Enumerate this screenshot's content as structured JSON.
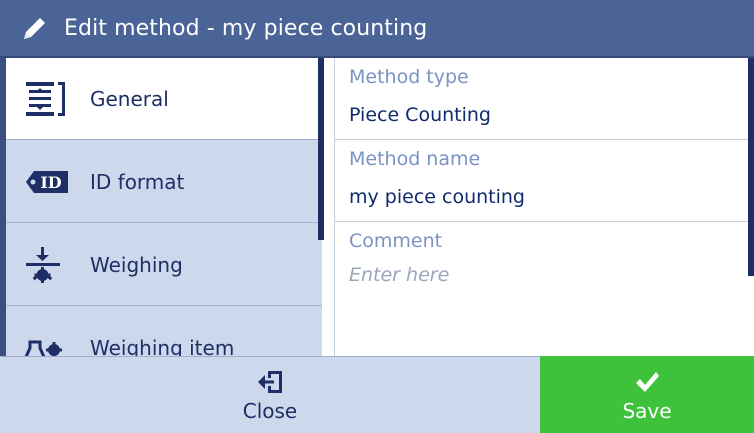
{
  "window": {
    "title": "Edit method - my piece counting",
    "title_icon": "pencil-icon"
  },
  "nav": {
    "items": [
      {
        "label": "General",
        "icon": "general-list-icon",
        "selected": true
      },
      {
        "label": "ID format",
        "icon": "id-tag-icon",
        "selected": false
      },
      {
        "label": "Weighing",
        "icon": "weighing-gear-icon",
        "selected": false
      },
      {
        "label": "Weighing item",
        "icon": "weighing-item-flask-icon",
        "selected": false
      }
    ]
  },
  "detail": {
    "method_type": {
      "label": "Method type",
      "value": "Piece Counting"
    },
    "method_name": {
      "label": "Method name",
      "value": "my piece counting"
    },
    "comment": {
      "label": "Comment",
      "placeholder": "Enter here"
    }
  },
  "footer": {
    "close_label": "Close",
    "close_icon": "exit-door-icon",
    "save_label": "Save",
    "save_icon": "checkmark-icon"
  },
  "colors": {
    "title_bar": "#4a6497",
    "nav_background": "#cdd8ec",
    "nav_selected": "#ffffff",
    "text_dark": "#1d2f66",
    "field_label": "#7b93c4",
    "save_green": "#3ec23c"
  }
}
